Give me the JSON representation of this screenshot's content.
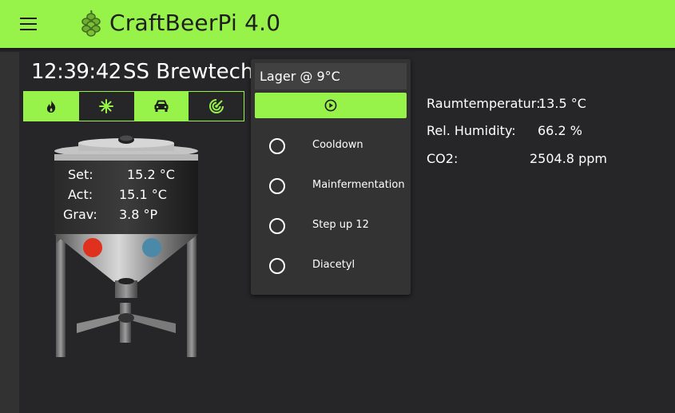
{
  "header": {
    "title": "CraftBeerPi 4.0",
    "accent": "#97f34a"
  },
  "dashboard": {
    "clock": "12:39:42",
    "fermenter_name": "SS Brewtech"
  },
  "actors": [
    {
      "icon": "flame-icon",
      "state": "on"
    },
    {
      "icon": "snowflake-icon",
      "state": "off"
    },
    {
      "icon": "car-icon",
      "state": "on"
    },
    {
      "icon": "target-icon",
      "state": "off"
    }
  ],
  "fermenter": {
    "set_label": "Set:",
    "set_value": "15.2 °C",
    "act_label": "Act:",
    "act_value": "15.1 °C",
    "grav_label": "Grav:",
    "grav_value": "3.8 °P",
    "heater_color": "#e0301e",
    "cooler_color": "#4a8aa8"
  },
  "steps": {
    "title": "Lager @ 9°C",
    "start_icon": "play-circle-icon",
    "items": [
      {
        "label": "Cooldown"
      },
      {
        "label": "Mainfermentation"
      },
      {
        "label": "Step up 12"
      },
      {
        "label": "Diacetyl"
      }
    ]
  },
  "sensors": [
    {
      "label": "Raumtemperatur:",
      "value": "13.5 °C"
    },
    {
      "label": "Rel. Humidity:",
      "value": "66.2 %"
    },
    {
      "label": "CO2:",
      "value": "2504.8 ppm"
    }
  ]
}
